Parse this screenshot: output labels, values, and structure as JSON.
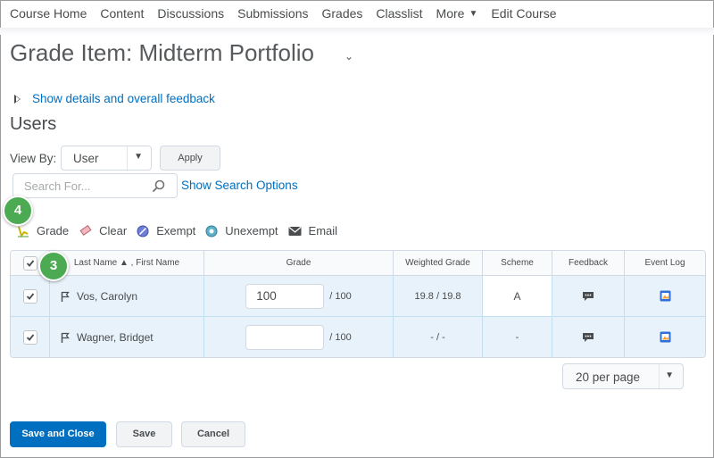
{
  "nav": {
    "items": [
      "Course Home",
      "Content",
      "Discussions",
      "Submissions",
      "Grades",
      "Classlist",
      "More",
      "Edit Course"
    ]
  },
  "page_title": "Grade Item: Midterm Portfolio",
  "details_link": "Show details and overall feedback",
  "users_heading": "Users",
  "view_by": {
    "label": "View By:",
    "selected": "User",
    "apply_label": "Apply"
  },
  "search": {
    "placeholder": "Search For...",
    "options_link": "Show Search Options"
  },
  "callouts": {
    "grade_actions": "4",
    "select_all": "3"
  },
  "actions": [
    {
      "label": "Grade",
      "icon": "grade-icon"
    },
    {
      "label": "Clear",
      "icon": "eraser-icon"
    },
    {
      "label": "Exempt",
      "icon": "exempt-icon"
    },
    {
      "label": "Unexempt",
      "icon": "unexempt-icon"
    },
    {
      "label": "Email",
      "icon": "email-icon"
    }
  ],
  "table": {
    "headers": {
      "name": "Last Name ▲ , First Name",
      "grade": "Grade",
      "weighted": "Weighted Grade",
      "scheme": "Scheme",
      "feedback": "Feedback",
      "event_log": "Event Log"
    },
    "rows": [
      {
        "name": "Vos, Carolyn",
        "grade": "100",
        "out_of": "/ 100",
        "weighted": "19.8 / 19.8",
        "scheme": "A",
        "checked": true
      },
      {
        "name": "Wagner, Bridget",
        "grade": "",
        "out_of": "/ 100",
        "weighted": "- / -",
        "scheme": "-",
        "checked": true
      }
    ]
  },
  "per_page": "20 per page",
  "buttons": {
    "save_close": "Save and Close",
    "save": "Save",
    "cancel": "Cancel"
  },
  "colors": {
    "link": "#006fbf",
    "primary": "#006fbf",
    "callout": "#4caa52",
    "row_highlight": "#e8f2fa"
  }
}
